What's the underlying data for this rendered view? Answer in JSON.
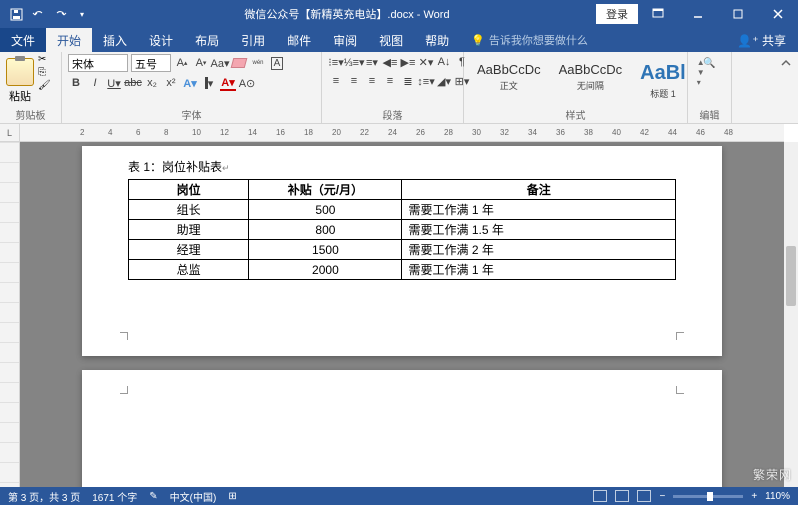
{
  "title": "微信公众号【新精英充电站】.docx - Word",
  "login": "登录",
  "tabs": {
    "file": "文件",
    "home": "开始",
    "insert": "插入",
    "design": "设计",
    "layout": "布局",
    "references": "引用",
    "mail": "邮件",
    "review": "审阅",
    "view": "视图",
    "help": "帮助",
    "tellme": "告诉我你想要做什么",
    "share": "共享"
  },
  "ribbon": {
    "clipboard": {
      "label": "剪贴板",
      "paste": "粘贴"
    },
    "font": {
      "label": "字体",
      "name": "宋体",
      "size": "五号"
    },
    "para": {
      "label": "段落"
    },
    "styles": {
      "label": "样式",
      "normal_sample": "AaBbCcDc",
      "normal": "正文",
      "nospacing_sample": "AaBbCcDc",
      "nospacing": "无间隔",
      "h1_sample": "AaBl",
      "h1": "标题 1"
    },
    "editing": {
      "label": "编辑"
    }
  },
  "doc": {
    "caption": "表 1：岗位补贴表",
    "headers": [
      "岗位",
      "补贴（元/月）",
      "备注"
    ],
    "rows": [
      [
        "组长",
        "500",
        "需要工作满 1 年"
      ],
      [
        "助理",
        "800",
        "需要工作满 1.5 年"
      ],
      [
        "经理",
        "1500",
        "需要工作满 2 年"
      ],
      [
        "总监",
        "2000",
        "需要工作满 1 年"
      ]
    ]
  },
  "status": {
    "page": "第 3 页，共 3 页",
    "words": "1671 个字",
    "lang": "中文(中国)",
    "zoom": "110%"
  },
  "watermark": "繁荣网",
  "ruler_nums": [
    2,
    4,
    6,
    8,
    10,
    12,
    14,
    16,
    18,
    20,
    22,
    24,
    26,
    28,
    30,
    32,
    34,
    36,
    38,
    40,
    42,
    44,
    46,
    48
  ]
}
